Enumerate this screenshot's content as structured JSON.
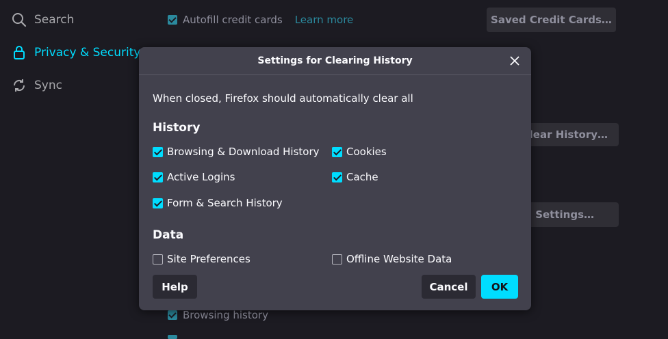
{
  "sidebar": {
    "items": [
      {
        "label": "Search",
        "icon": "search-icon"
      },
      {
        "label": "Privacy & Security",
        "icon": "lock-icon"
      },
      {
        "label": "Sync",
        "icon": "sync-icon"
      }
    ]
  },
  "background": {
    "autofill_label": "Autofill credit cards",
    "learn_more": "Learn more",
    "saved_cards_button": "Saved Credit Cards…",
    "clear_history_button": "Clear History…",
    "settings_button": "Settings…",
    "browsing_history_label": "Browsing history"
  },
  "dialog": {
    "title": "Settings for Clearing History",
    "intro": "When closed, Firefox should automatically clear all",
    "history_title": "History",
    "history_items": [
      {
        "label": "Browsing & Download History",
        "checked": true
      },
      {
        "label": "Cookies",
        "checked": true
      },
      {
        "label": "Active Logins",
        "checked": true
      },
      {
        "label": "Cache",
        "checked": true
      },
      {
        "label": "Form & Search History",
        "checked": true
      }
    ],
    "data_title": "Data",
    "data_items": [
      {
        "label": "Site Preferences",
        "checked": false
      },
      {
        "label": "Offline Website Data",
        "checked": false
      }
    ],
    "help_button": "Help",
    "cancel_button": "Cancel",
    "ok_button": "OK"
  },
  "colors": {
    "accent": "#00ddff",
    "dialog_bg": "#42414d",
    "page_bg": "#1c1b22"
  }
}
